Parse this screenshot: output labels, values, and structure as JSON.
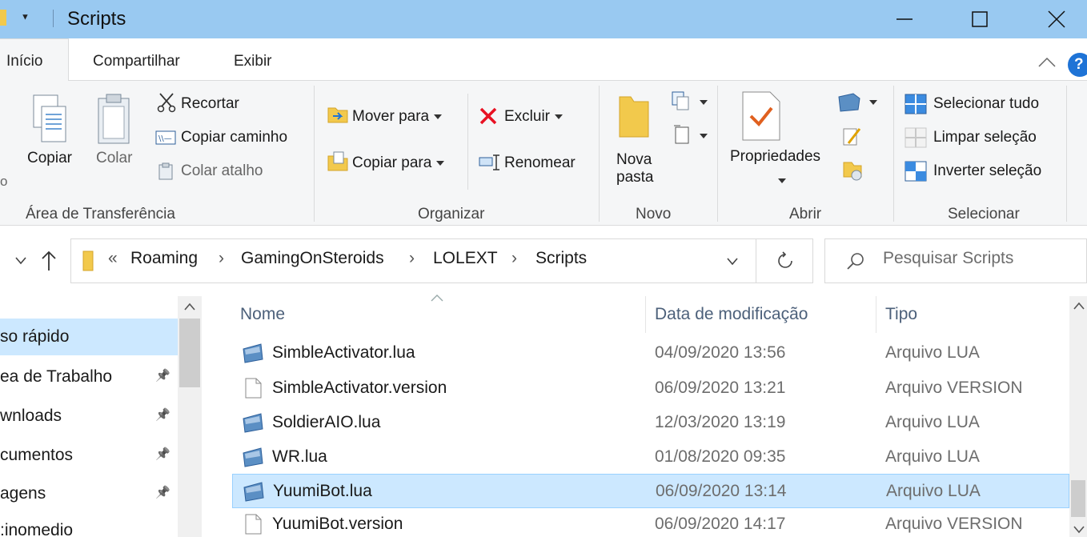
{
  "window": {
    "title": "Scripts",
    "quick_access_glyph": "▼",
    "controls": {
      "minimize": "minimize-icon",
      "maximize": "maximize-icon",
      "close": "close-icon"
    }
  },
  "ribbon_tabs": [
    "Início",
    "Compartilhar",
    "Exibir"
  ],
  "ribbon": {
    "clipboard": {
      "label": "Área de Transferência",
      "copiar": "Copiar",
      "colar": "Colar",
      "recortar": "Recortar",
      "copiar_caminho": "Copiar caminho",
      "colar_atalho": "Colar atalho",
      "edge_letter": "o"
    },
    "organizar": {
      "label": "Organizar",
      "mover_para": "Mover para",
      "copiar_para": "Copiar para",
      "excluir": "Excluir",
      "renomear": "Renomear"
    },
    "novo": {
      "label": "Novo",
      "nova_pasta_1": "Nova",
      "nova_pasta_2": "pasta"
    },
    "abrir": {
      "label": "Abrir",
      "propriedades": "Propriedades"
    },
    "selecionar": {
      "label": "Selecionar",
      "selecionar_tudo": "Selecionar tudo",
      "limpar_selecao": "Limpar seleção",
      "inverter_selecao": "Inverter seleção"
    }
  },
  "address": {
    "overflow": "«",
    "crumbs": [
      "Roaming",
      "GamingOnSteroids",
      "LOLEXT",
      "Scripts"
    ],
    "search_placeholder": "Pesquisar Scripts"
  },
  "nav_items": [
    {
      "label": "so rápido",
      "selected": true,
      "pinned": false
    },
    {
      "label": "ea de Trabalho",
      "selected": false,
      "pinned": true
    },
    {
      "label": "wnloads",
      "selected": false,
      "pinned": true
    },
    {
      "label": "cumentos",
      "selected": false,
      "pinned": true
    },
    {
      "label": "agens",
      "selected": false,
      "pinned": true
    },
    {
      "label": ":inomedio",
      "selected": false,
      "pinned": false
    }
  ],
  "columns": {
    "name": "Nome",
    "date": "Data de modificação",
    "type": "Tipo"
  },
  "files": [
    {
      "name": "SimbleActivator.lua",
      "date": "04/09/2020 13:56",
      "type": "Arquivo LUA",
      "icon": "lua-file-icon",
      "selected": false
    },
    {
      "name": "SimbleActivator.version",
      "date": "06/09/2020 13:21",
      "type": "Arquivo VERSION",
      "icon": "blank-file-icon",
      "selected": false
    },
    {
      "name": "SoldierAIO.lua",
      "date": "12/03/2020 13:19",
      "type": "Arquivo LUA",
      "icon": "lua-file-icon",
      "selected": false
    },
    {
      "name": "WR.lua",
      "date": "01/08/2020 09:35",
      "type": "Arquivo LUA",
      "icon": "lua-file-icon",
      "selected": false
    },
    {
      "name": "YuumiBot.lua",
      "date": "06/09/2020 13:14",
      "type": "Arquivo LUA",
      "icon": "lua-file-icon",
      "selected": true
    },
    {
      "name": "YuumiBot.version",
      "date": "06/09/2020 14:17",
      "type": "Arquivo VERSION",
      "icon": "blank-file-icon",
      "selected": false
    }
  ],
  "colors": {
    "titlebar": "#99c9f1",
    "selection": "#cce8ff",
    "folder": "#f2c94c",
    "delete_red": "#e81123",
    "header_text": "#4c607a"
  }
}
